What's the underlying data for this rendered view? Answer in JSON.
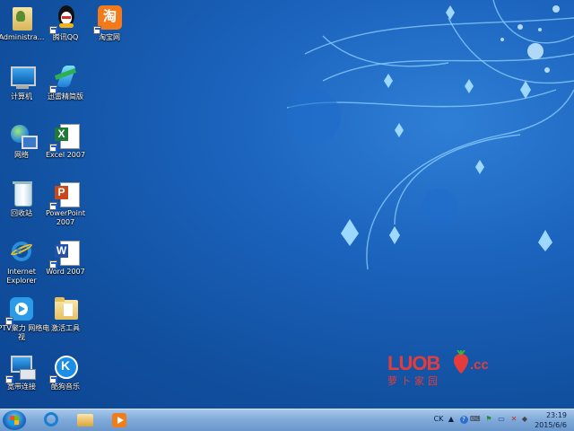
{
  "desktop": {
    "icons": [
      {
        "label": "Administra...",
        "icon": "user-folder-icon"
      },
      {
        "label": "腾讯QQ",
        "icon": "qq-penguin-icon"
      },
      {
        "label": "淘宝网",
        "icon": "taobao-icon"
      },
      {
        "label": "计算机",
        "icon": "computer-icon"
      },
      {
        "label": "迅雷精简版",
        "icon": "thunder-icon"
      },
      {
        "label": "网络",
        "icon": "network-icon"
      },
      {
        "label": "Excel 2007",
        "icon": "excel-icon"
      },
      {
        "label": "回收站",
        "icon": "recycle-bin-icon"
      },
      {
        "label": "PowerPoint 2007",
        "icon": "powerpoint-icon"
      },
      {
        "label": "Internet Explorer",
        "icon": "internet-explorer-icon"
      },
      {
        "label": "Word 2007",
        "icon": "word-icon"
      },
      {
        "label": "PPTV聚力 网络电视",
        "icon": "pptv-icon"
      },
      {
        "label": "激活工具",
        "icon": "folder-icon"
      },
      {
        "label": "宽带连接",
        "icon": "broadband-connection-icon"
      },
      {
        "label": "酷狗音乐",
        "icon": "kugou-music-icon"
      }
    ],
    "logo": {
      "main": "LUOB",
      "suffix": ".cc",
      "sub": "萝卜家园"
    }
  },
  "taskbar": {
    "pinned": [
      "internet-explorer-icon",
      "file-explorer-icon",
      "media-player-icon"
    ],
    "tray": {
      "lang": "CK",
      "clock_time": "23:19",
      "clock_date": "2015/6/6"
    }
  },
  "colors": {
    "desktop": "#1b63bd",
    "taskbar": "#7fa9d9",
    "logo": "#e63b3b"
  }
}
